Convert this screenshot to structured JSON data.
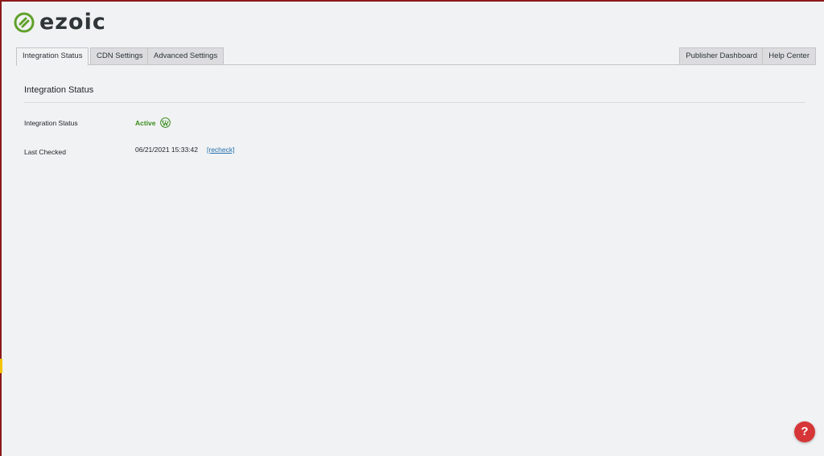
{
  "brand": {
    "name": "ezoic",
    "color": "#5fa12a"
  },
  "tabs": {
    "left": [
      {
        "label": "Integration Status",
        "active": true
      },
      {
        "label": "CDN Settings",
        "active": false
      },
      {
        "label": "Advanced Settings",
        "active": false
      }
    ],
    "right": [
      {
        "label": "Publisher Dashboard"
      },
      {
        "label": "Help Center"
      }
    ]
  },
  "section": {
    "title": "Integration Status"
  },
  "fields": {
    "integration_status": {
      "label": "Integration Status",
      "value": "Active",
      "icon": "wordpress-icon",
      "color": "#3a8c1f"
    },
    "last_checked": {
      "label": "Last Checked",
      "value": "06/21/2021 15:33:42",
      "action": "[recheck]"
    }
  },
  "help": {
    "label": "?",
    "icon": "help-icon",
    "color": "#d63638"
  }
}
